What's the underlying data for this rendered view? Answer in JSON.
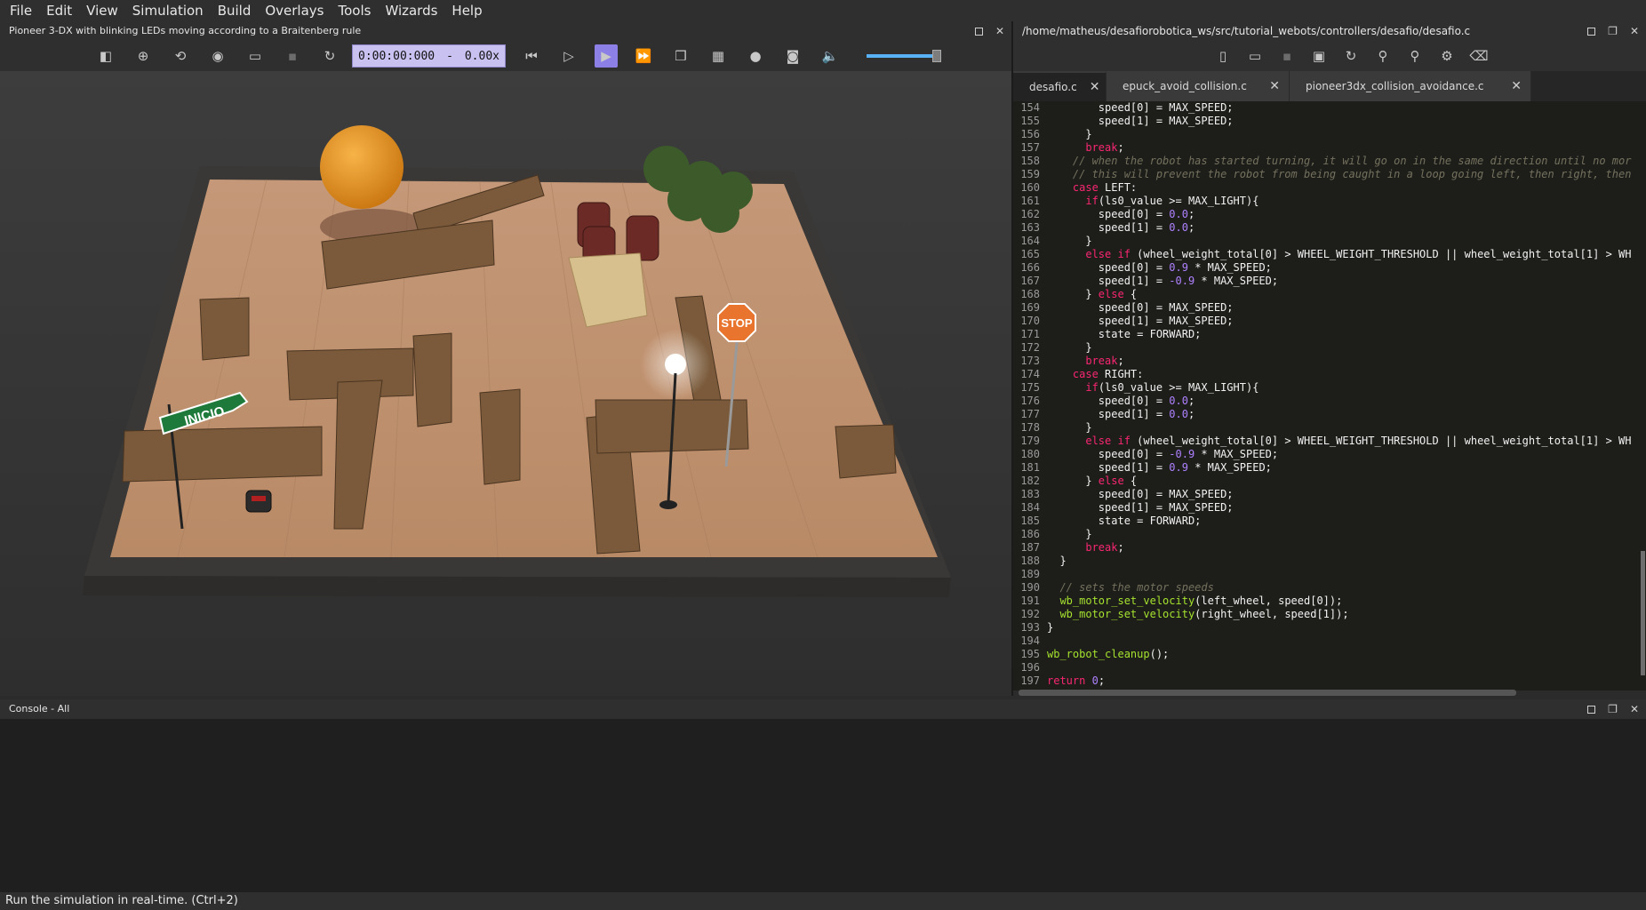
{
  "menu": [
    "File",
    "Edit",
    "View",
    "Simulation",
    "Build",
    "Overlays",
    "Tools",
    "Wizards",
    "Help"
  ],
  "scene": {
    "title": "Pioneer 3-DX with blinking LEDs moving according to a Braitenberg rule",
    "time": "0:00:00:000",
    "time_sep": "-",
    "speed": "0.00x",
    "sign_start": "INICIO",
    "sign_stop": "STOP"
  },
  "editor": {
    "path": "/home/matheus/desafiorobotica_ws/src/tutorial_webots/controllers/desafio/desafio.c",
    "tabs": [
      "desafio.c",
      "epuck_avoid_collision.c",
      "pioneer3dx_collision_avoidance.c"
    ],
    "lines": [
      {
        "n": "154",
        "t": "        speed[0] = MAX_SPEED;"
      },
      {
        "n": "155",
        "t": "        speed[1] = MAX_SPEED;"
      },
      {
        "n": "156",
        "t": "      }"
      },
      {
        "n": "157",
        "t": "      break;"
      },
      {
        "n": "158",
        "t": "    // when the robot has started turning, it will go on in the same direction until no mor"
      },
      {
        "n": "159",
        "t": "    // this will prevent the robot from being caught in a loop going left, then right, then"
      },
      {
        "n": "160",
        "t": "    case LEFT:"
      },
      {
        "n": "161",
        "t": "      if(ls0_value >= MAX_LIGHT){"
      },
      {
        "n": "162",
        "t": "        speed[0] = 0.0;"
      },
      {
        "n": "163",
        "t": "        speed[1] = 0.0;"
      },
      {
        "n": "164",
        "t": "      }"
      },
      {
        "n": "165",
        "t": "      else if (wheel_weight_total[0] > WHEEL_WEIGHT_THRESHOLD || wheel_weight_total[1] > WH"
      },
      {
        "n": "166",
        "t": "        speed[0] = 0.9 * MAX_SPEED;"
      },
      {
        "n": "167",
        "t": "        speed[1] = -0.9 * MAX_SPEED;"
      },
      {
        "n": "168",
        "t": "      } else {"
      },
      {
        "n": "169",
        "t": "        speed[0] = MAX_SPEED;"
      },
      {
        "n": "170",
        "t": "        speed[1] = MAX_SPEED;"
      },
      {
        "n": "171",
        "t": "        state = FORWARD;"
      },
      {
        "n": "172",
        "t": "      }"
      },
      {
        "n": "173",
        "t": "      break;"
      },
      {
        "n": "174",
        "t": "    case RIGHT:"
      },
      {
        "n": "175",
        "t": "      if(ls0_value >= MAX_LIGHT){"
      },
      {
        "n": "176",
        "t": "        speed[0] = 0.0;"
      },
      {
        "n": "177",
        "t": "        speed[1] = 0.0;"
      },
      {
        "n": "178",
        "t": "      }"
      },
      {
        "n": "179",
        "t": "      else if (wheel_weight_total[0] > WHEEL_WEIGHT_THRESHOLD || wheel_weight_total[1] > WH"
      },
      {
        "n": "180",
        "t": "        speed[0] = -0.9 * MAX_SPEED;"
      },
      {
        "n": "181",
        "t": "        speed[1] = 0.9 * MAX_SPEED;"
      },
      {
        "n": "182",
        "t": "      } else {"
      },
      {
        "n": "183",
        "t": "        speed[0] = MAX_SPEED;"
      },
      {
        "n": "184",
        "t": "        speed[1] = MAX_SPEED;"
      },
      {
        "n": "185",
        "t": "        state = FORWARD;"
      },
      {
        "n": "186",
        "t": "      }"
      },
      {
        "n": "187",
        "t": "      break;"
      },
      {
        "n": "188",
        "t": "  }"
      },
      {
        "n": "189",
        "t": ""
      },
      {
        "n": "190",
        "t": "  // sets the motor speeds"
      },
      {
        "n": "191",
        "t": "  wb_motor_set_velocity(left_wheel, speed[0]);"
      },
      {
        "n": "192",
        "t": "  wb_motor_set_velocity(right_wheel, speed[1]);"
      },
      {
        "n": "193",
        "t": "}"
      },
      {
        "n": "194",
        "t": ""
      },
      {
        "n": "195",
        "t": "wb_robot_cleanup();"
      },
      {
        "n": "196",
        "t": ""
      },
      {
        "n": "197",
        "t": "return 0;"
      }
    ]
  },
  "console": {
    "title": "Console - All"
  },
  "status": "Run the simulation in real-time. (Ctrl+2)"
}
